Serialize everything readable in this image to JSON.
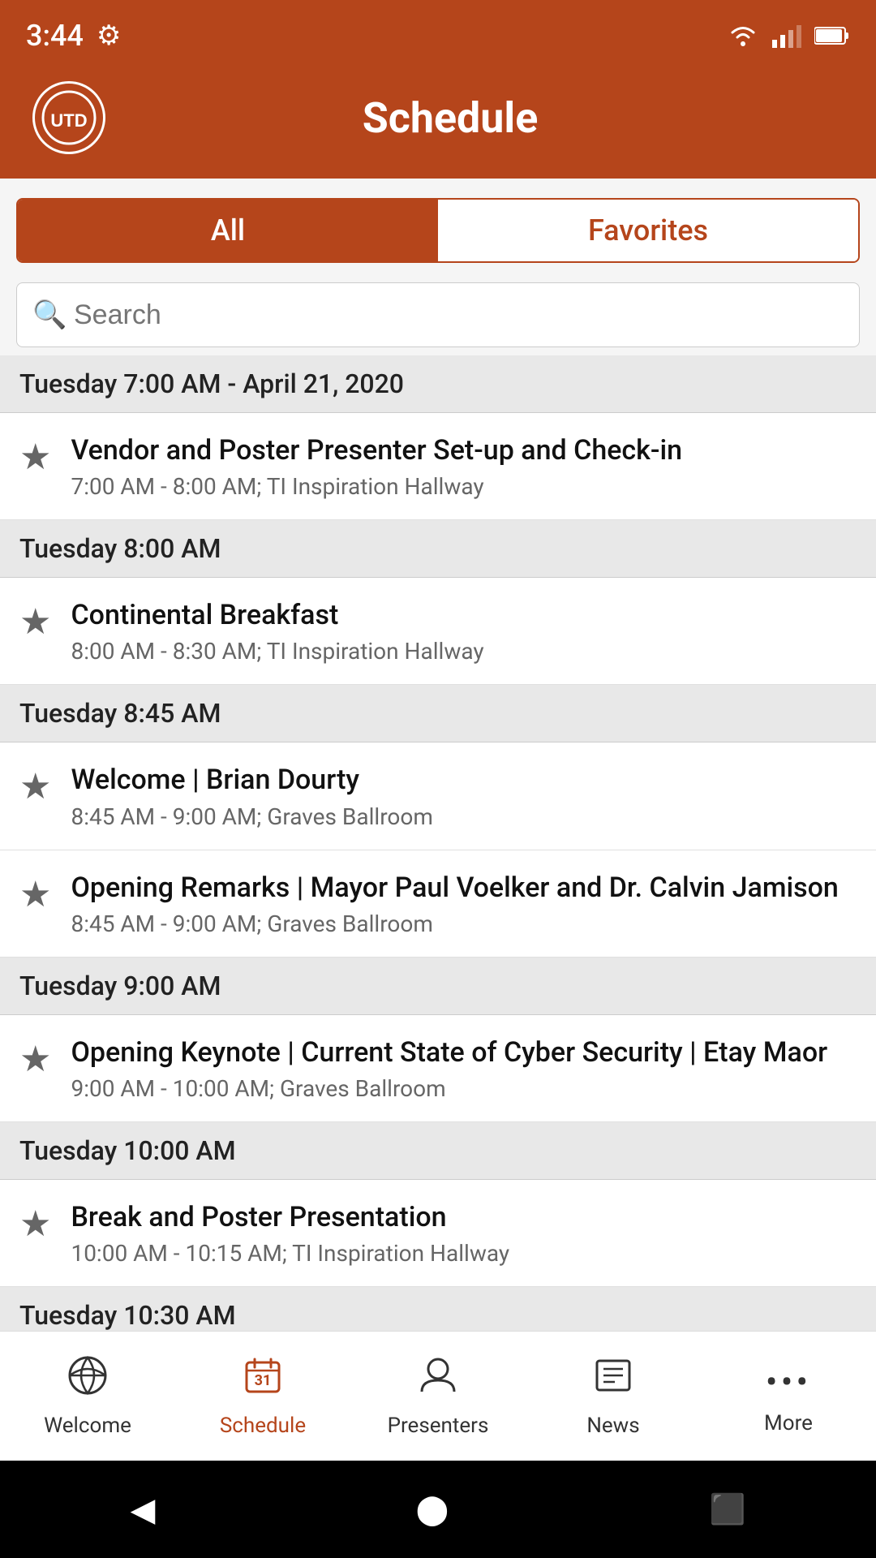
{
  "statusBar": {
    "time": "3:44",
    "settingsIcon": "⚙"
  },
  "header": {
    "logoText": "UTD",
    "title": "Schedule"
  },
  "tabs": {
    "all": "All",
    "favorites": "Favorites"
  },
  "search": {
    "placeholder": "Search"
  },
  "sections": [
    {
      "id": "section-7am",
      "header": "Tuesday 7:00 AM - April 21, 2020",
      "items": [
        {
          "id": "item-1",
          "title": "Vendor and Poster Presenter Set-up and Check-in",
          "meta": "7:00 AM - 8:00 AM; TI Inspiration Hallway"
        }
      ]
    },
    {
      "id": "section-8am",
      "header": "Tuesday 8:00 AM",
      "items": [
        {
          "id": "item-2",
          "title": "Continental Breakfast",
          "meta": "8:00 AM - 8:30 AM; TI Inspiration Hallway"
        }
      ]
    },
    {
      "id": "section-845am",
      "header": "Tuesday 8:45 AM",
      "items": [
        {
          "id": "item-3",
          "title": "Welcome | Brian Dourty",
          "meta": "8:45 AM - 9:00 AM; Graves Ballroom"
        },
        {
          "id": "item-4",
          "title": "Opening Remarks | Mayor Paul Voelker and Dr. Calvin Jamison",
          "meta": "8:45 AM - 9:00 AM; Graves Ballroom"
        }
      ]
    },
    {
      "id": "section-9am",
      "header": "Tuesday 9:00 AM",
      "items": [
        {
          "id": "item-5",
          "title": "Opening Keynote | Current State of Cyber Security | Etay Maor",
          "meta": "9:00 AM - 10:00 AM; Graves Ballroom"
        }
      ]
    },
    {
      "id": "section-10am",
      "header": "Tuesday 10:00 AM",
      "items": [
        {
          "id": "item-6",
          "title": "Break and Poster Presentation",
          "meta": "10:00 AM - 10:15 AM; TI Inspiration Hallway"
        }
      ]
    },
    {
      "id": "section-1030am",
      "header": "Tuesday 10:30 AM",
      "items": []
    }
  ],
  "bottomNav": [
    {
      "id": "welcome",
      "label": "Welcome",
      "icon": "🌐",
      "active": false
    },
    {
      "id": "schedule",
      "label": "Schedule",
      "icon": "📅",
      "active": true
    },
    {
      "id": "presenters",
      "label": "Presenters",
      "icon": "👤",
      "active": false
    },
    {
      "id": "news",
      "label": "News",
      "icon": "📰",
      "active": false
    },
    {
      "id": "more",
      "label": "More",
      "icon": "•••",
      "active": false
    }
  ]
}
